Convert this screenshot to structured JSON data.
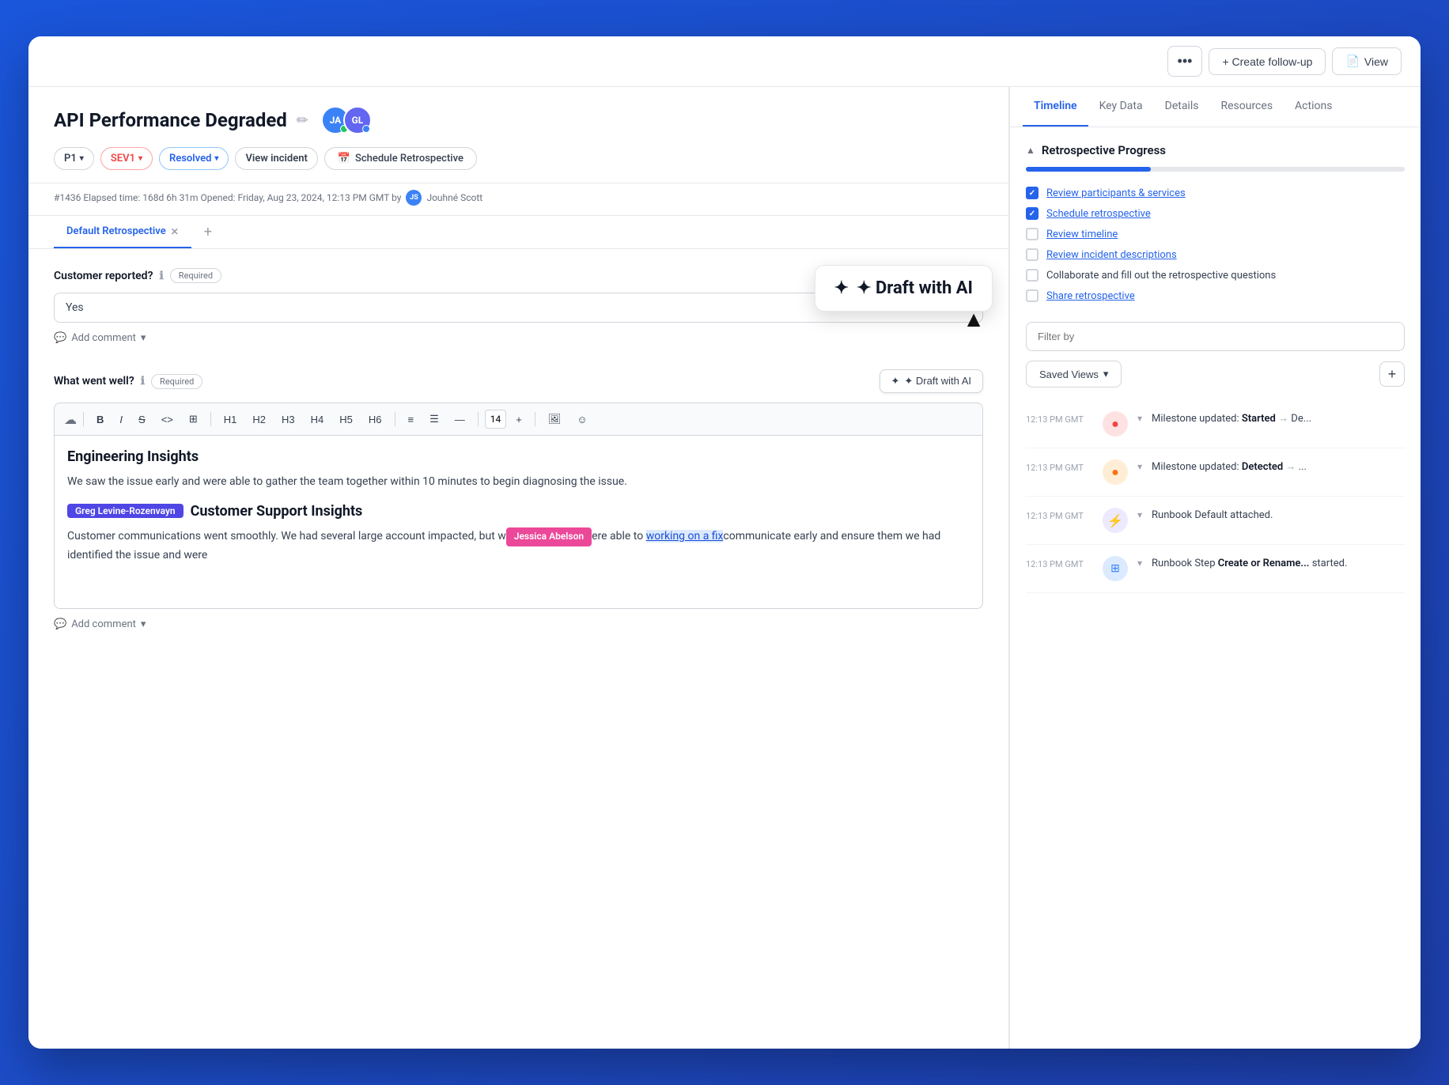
{
  "app": {
    "title": "API Performance Degraded",
    "top_bar": {
      "more_label": "•••",
      "create_follow_up": "+ Create follow-up",
      "view": "View"
    }
  },
  "incident": {
    "title": "API Performance Degraded",
    "badges": {
      "priority": "P1",
      "severity": "SEV1",
      "status": "Resolved",
      "view_incident": "View incident",
      "schedule": "Schedule Retrospective"
    },
    "meta": "#1436  Elapsed time: 168d 6h 31m  Opened: Friday, Aug 23, 2024, 12:13 PM GMT by",
    "author": "Jouhné Scott",
    "avatars": [
      {
        "initials": "JA",
        "color": "#3b82f6",
        "dot": "green"
      },
      {
        "initials": "GL",
        "color": "#6366f1",
        "dot": "blue"
      }
    ]
  },
  "retro_tabs": {
    "active_tab": "Default Retrospective",
    "add_tab": "+"
  },
  "form": {
    "customer_reported": {
      "label": "Customer reported?",
      "required_label": "Required",
      "value": "Yes",
      "add_comment": "Add comment"
    },
    "what_went_well": {
      "label": "What went well?",
      "required_label": "Required",
      "draft_ai_label": "✦ Draft with AI",
      "draft_ai_popup": "✦ Draft with AI",
      "toolbar": {
        "bold": "B",
        "italic": "I",
        "strikethrough": "S",
        "code": "<>",
        "table": "⊞",
        "h1": "H1",
        "h2": "H2",
        "h3": "H3",
        "h4": "H4",
        "h5": "H5",
        "h6": "H6",
        "bullet": "≡",
        "ordered": "☰",
        "minus": "—",
        "font_size": "14",
        "plus": "+",
        "image": "🖼",
        "emoji": "☺"
      },
      "content_heading1": "Engineering Insights",
      "content_para1": "We saw the issue early and were able to gather the team together within 10 minutes to begin diagnosing the issue.",
      "content_heading2": "Customer Support Insights",
      "mention_name": "Greg Levine-Rozenvayn",
      "mention_name2": "Jessica Abelson",
      "content_para2_before": "Customer communications went smoothly. We had several large account impacted, but w",
      "content_para2_middle": "ere able to",
      "content_highlight": "working on a fix",
      "content_para2_after": "communicate early and ensure them we had identified the issue and were",
      "add_comment": "Add comment"
    }
  },
  "right_panel": {
    "tabs": [
      "Timeline",
      "Key Data",
      "Details",
      "Resources",
      "Actions"
    ],
    "active_tab": "Timeline",
    "retro_progress": {
      "title": "Retrospective Progress",
      "progress_percent": 33,
      "checklist": [
        {
          "label": "Review participants & services",
          "checked": true,
          "is_link": true
        },
        {
          "label": "Schedule retrospective",
          "checked": true,
          "is_link": true
        },
        {
          "label": "Review timeline",
          "checked": false,
          "is_link": true
        },
        {
          "label": "Review incident descriptions",
          "checked": false,
          "is_link": true
        },
        {
          "label": "Collaborate and fill out the retrospective questions",
          "checked": false,
          "is_link": false
        },
        {
          "label": "Share retrospective",
          "checked": false,
          "is_link": true
        }
      ]
    },
    "filter_placeholder": "Filter by",
    "saved_views": "Saved Views",
    "timeline_events": [
      {
        "time": "12:13 PM GMT",
        "icon_type": "red",
        "icon_symbol": "◉",
        "text_before": "Milestone updated: ",
        "text_bold": "Started",
        "text_arrow": " → De...",
        "has_chevron": true
      },
      {
        "time": "12:13 PM GMT",
        "icon_type": "orange",
        "icon_symbol": "◉",
        "text_before": "Milestone updated: ",
        "text_bold": "Detected",
        "text_arrow": " → ...",
        "has_chevron": true
      },
      {
        "time": "12:13 PM GMT",
        "icon_type": "purple",
        "icon_symbol": "⚡",
        "text_before": "Runbook Default attached.",
        "text_bold": "",
        "text_arrow": "",
        "has_chevron": true
      },
      {
        "time": "12:13 PM GMT",
        "icon_type": "blue",
        "icon_symbol": "⊞",
        "text_before": "Runbook Step ",
        "text_bold": "Create or Rename...",
        "text_arrow": " started.",
        "has_chevron": true
      }
    ]
  }
}
